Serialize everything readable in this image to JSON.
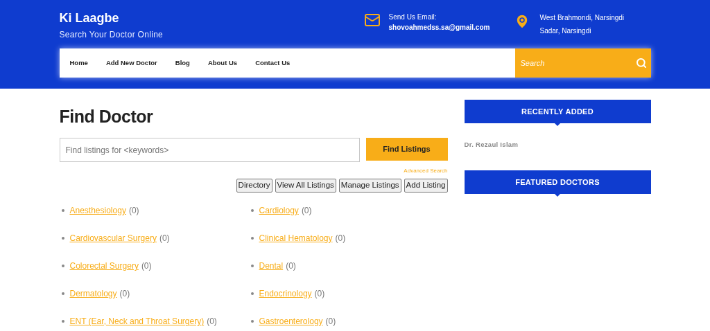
{
  "site": {
    "title": "Ki Laagbe",
    "tagline": "Search Your Doctor Online"
  },
  "contact": {
    "email_label": "Send Us Email:",
    "email": "shovoahmedss.sa@gmail.com",
    "address_lines": [
      "West Brahmondi, Narsingdi",
      "Sadar, Narsingdi"
    ]
  },
  "nav": {
    "items": [
      "Home",
      "Add New Doctor",
      "Blog",
      "About Us",
      "Contact Us"
    ],
    "search": {
      "placeholder": "Search"
    }
  },
  "page": {
    "title": "Find Doctor",
    "search": {
      "placeholder": "Find listings for <keywords>"
    },
    "find_button": "Find Listings",
    "advanced_link": "Advanced Search",
    "actions": [
      "Directory",
      "View All Listings",
      "Manage Listings",
      "Add Listing"
    ],
    "categories": [
      {
        "name": "Anesthesiology",
        "count": "(0)"
      },
      {
        "name": "Cardiology",
        "count": "(0)"
      },
      {
        "name": "Cardiovascular Surgery",
        "count": "(0)"
      },
      {
        "name": "Clinical Hematology",
        "count": "(0)"
      },
      {
        "name": "Colorectal Surgery",
        "count": "(0)"
      },
      {
        "name": "Dental",
        "count": "(0)"
      },
      {
        "name": "Dermatology",
        "count": "(0)"
      },
      {
        "name": "Endocrinology",
        "count": "(0)"
      },
      {
        "name": "ENT (Ear, Neck and Throat Surgery)",
        "count": "(0)"
      },
      {
        "name": "Gastroenterology",
        "count": "(0)"
      }
    ]
  },
  "sidebar": {
    "widgets": [
      {
        "title": "RECENTLY ADDED",
        "items": [
          "Dr. Rezaul Islam"
        ]
      },
      {
        "title": "FEATURED DOCTORS"
      }
    ]
  }
}
